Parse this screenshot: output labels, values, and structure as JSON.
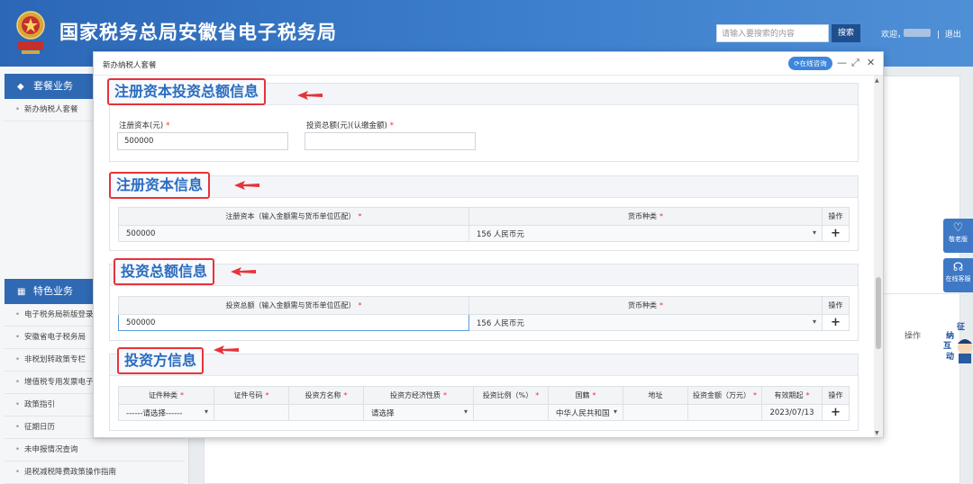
{
  "header": {
    "site_title": "国家税务总局安徽省电子税务局",
    "search_placeholder": "请输入要搜索的内容",
    "search_button": "搜索",
    "welcome": "欢迎，",
    "separator": "|",
    "logout": "退出",
    "colors": {
      "primary": "#2b67b6",
      "accent": "#e8323a"
    }
  },
  "sidebar": {
    "section1": {
      "title": "套餐业务",
      "icon": "layers-icon",
      "items": [
        "新办纳税人套餐"
      ]
    },
    "section2": {
      "title": "特色业务",
      "icon": "grid-icon",
      "items": [
        "电子税务局新版登录",
        "安徽省电子税务局",
        "非税划转政策专栏",
        "增值税专用发票电子",
        "政策指引",
        "征期日历",
        "未申报情况查询",
        "退税减税降费政策操作指南"
      ]
    }
  },
  "background": {
    "op_label": "操作"
  },
  "floating": {
    "elder_label": "敬老版",
    "online_service_label": "在线客服",
    "mascot_chars": [
      "征",
      "纳",
      "互",
      "动"
    ]
  },
  "modal": {
    "title": "新办纳税人套餐",
    "consult_label": "在线咨询",
    "minimize": "—",
    "maximize": "⤢",
    "close": "✕",
    "sections": {
      "s1": {
        "title": "注册资本投资总额信息",
        "reg_capital_label": "注册资本(元)",
        "reg_capital_value": "500000",
        "invest_total_label": "投资总额(元)(认缴金额)",
        "invest_total_value": ""
      },
      "s2": {
        "title": "注册资本信息",
        "col_amount": "注册资本（输入金额需与货币单位匹配）",
        "col_currency": "货币种类",
        "col_op": "操作",
        "row": {
          "amount": "500000",
          "currency": "156 人民币元",
          "op": "+"
        }
      },
      "s3": {
        "title": "投资总额信息",
        "col_amount": "投资总额（输入金额需与货币单位匹配）",
        "col_currency": "货币种类",
        "col_op": "操作",
        "row": {
          "amount": "500000",
          "currency": "156 人民币元",
          "op": "+"
        }
      },
      "s4": {
        "title": "投资方信息",
        "columns": [
          "证件种类",
          "证件号码",
          "投资方名称",
          "投资方经济性质",
          "投资比例（%）",
          "国籍",
          "地址",
          "投资金额（万元）",
          "有效期起",
          "操作"
        ],
        "required": [
          true,
          true,
          true,
          true,
          true,
          true,
          false,
          true,
          true,
          false
        ],
        "row": {
          "id_type": "------请选择------",
          "id_no": "",
          "name": "",
          "nature": "请选择",
          "ratio": "",
          "nationality": "中华人民共和国",
          "address": "",
          "amount": "",
          "valid_from": "2023/07/13",
          "op": "+"
        }
      }
    }
  }
}
